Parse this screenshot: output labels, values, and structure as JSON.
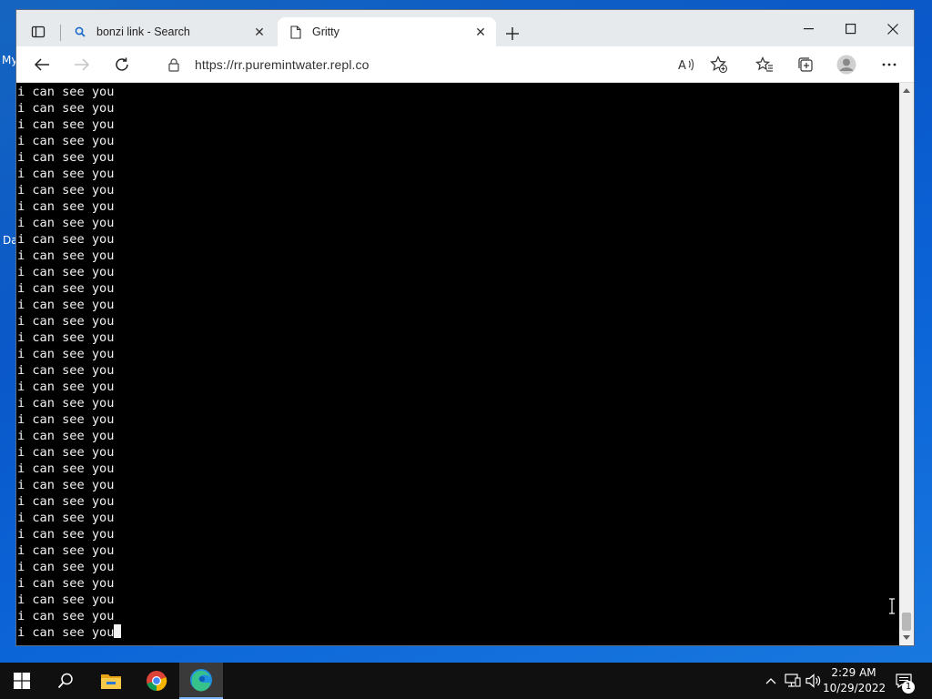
{
  "desktop": {
    "fragments": [
      "My",
      "Da"
    ]
  },
  "browser": {
    "tabs": [
      {
        "title": "bonzi link - Search",
        "icon": "search-icon"
      },
      {
        "title": "Gritty",
        "icon": "page-icon"
      }
    ],
    "address": {
      "url": "https://rr.puremintwater.repl.co"
    },
    "toolbar_icons": [
      "back-icon",
      "forward-icon",
      "refresh-icon",
      "read-aloud-icon",
      "add-favorite-icon",
      "favorites-icon",
      "collections-icon",
      "profile-icon",
      "more-icon"
    ]
  },
  "terminal": {
    "line_text": "i can see you",
    "line_count": 34
  },
  "taskbar": {
    "apps": [
      "start-icon",
      "search-icon",
      "file-explorer-icon",
      "chrome-icon",
      "edge-icon"
    ],
    "clock": {
      "time": "2:29 AM",
      "date": "10/29/2022"
    },
    "notification_count": "1"
  },
  "colors": {
    "desktop_bg": "#0b63d6",
    "terminal_bg": "#000000",
    "terminal_fg": "#f2f2f2",
    "taskbar_bg": "#101010",
    "edge_accent": "#1f8fe0"
  }
}
